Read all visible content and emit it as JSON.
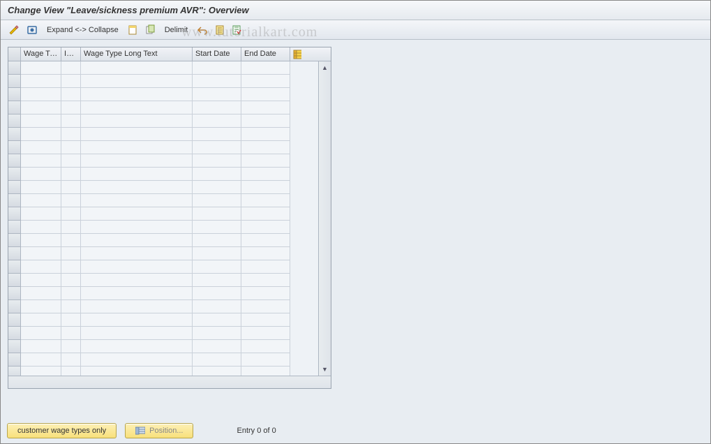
{
  "title": "Change View \"Leave/sickness premium AVR\": Overview",
  "toolbar": {
    "expand_collapse_label": "Expand <-> Collapse",
    "delimit_label": "Delimit"
  },
  "columns": {
    "wage_type": "Wage Ty...",
    "inf": "Inf...",
    "long_text": "Wage Type Long Text",
    "start_date": "Start Date",
    "end_date": "End Date"
  },
  "footer": {
    "customer_btn": "customer wage types only",
    "position_btn": "Position...",
    "entry_status": "Entry 0 of 0"
  },
  "watermark": "www.tutorialkart.com"
}
